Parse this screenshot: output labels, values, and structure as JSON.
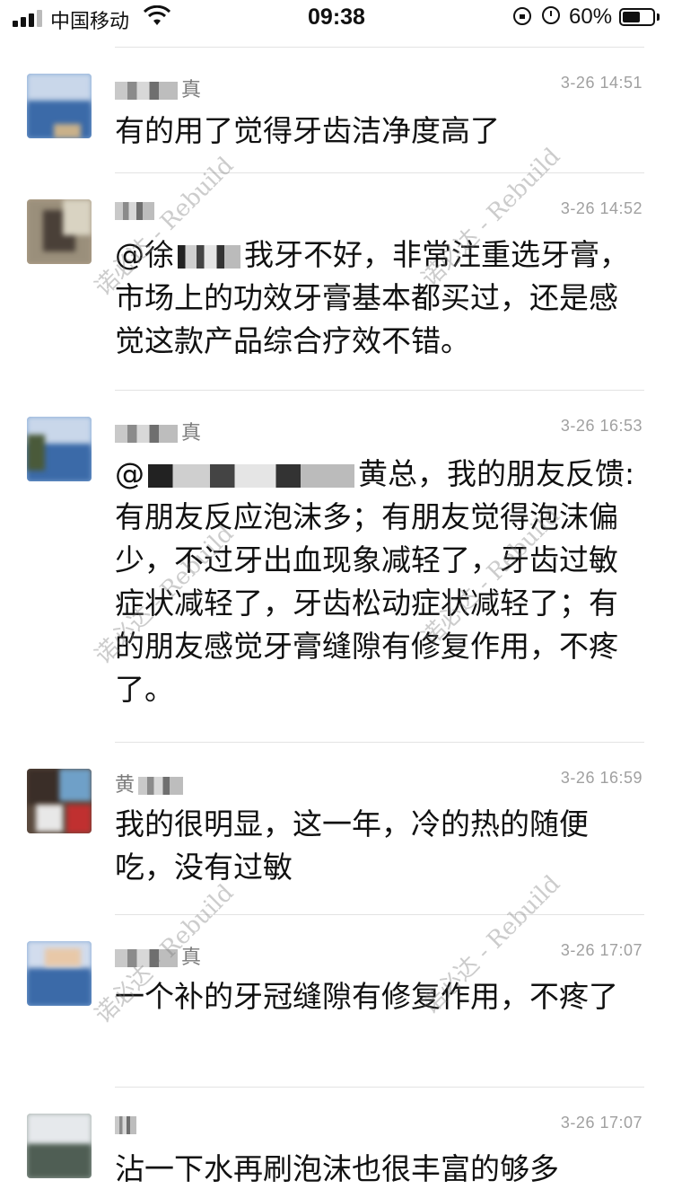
{
  "status_bar": {
    "carrier": "中国移动",
    "time": "09:38",
    "battery_percent": "60%",
    "battery_level": 0.6,
    "icons": [
      "signal-icon",
      "wifi-icon",
      "rotation-lock-icon",
      "alarm-icon",
      "battery-icon"
    ]
  },
  "comments": [
    {
      "name_visible": "真",
      "time": "3-26 14:51",
      "text": "有的用了觉得牙齿洁净度高了"
    },
    {
      "name_visible": "",
      "time": "3-26 14:52",
      "text_before": "@徐",
      "text_after": "我牙不好，非常注重选牙膏，市场上的功效牙膏基本都买过，还是感觉这款产品综合疗效不错。"
    },
    {
      "name_visible": "真",
      "time": "3-26 16:53",
      "text_before": "@",
      "text_after_mid": "黄总，我的朋友反馈:",
      "text_rest": "有朋友反应泡沫多；有朋友觉得泡沫偏少，不过牙出血现象减轻了，牙齿过敏症状减轻了，牙齿松动症状减轻了；有的朋友感觉牙膏缝隙有修复作用，不疼了。"
    },
    {
      "name_visible": "黄",
      "time": "3-26 16:59",
      "text": "我的很明显，这一年，冷的热的随便吃，没有过敏"
    },
    {
      "name_visible": "真",
      "time": "3-26 17:07",
      "text": "一个补的牙冠缝隙有修复作用，不疼了"
    },
    {
      "name_visible": "",
      "time": "3-26 17:07",
      "text": "沾一下水再刷泡沫也很丰富的够多"
    }
  ],
  "watermark": "诺必达 - Rebuild"
}
